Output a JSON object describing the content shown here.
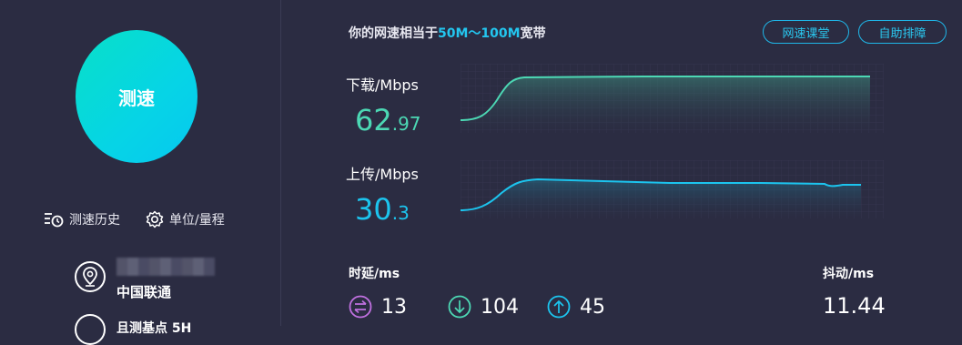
{
  "left": {
    "speed_button": "测速",
    "history_link": "测速历史",
    "units_link": "单位/量程",
    "isp_name": "中国联通",
    "cut_text": "且测基点 5H"
  },
  "header": {
    "equiv_prefix": "你的网速相当于",
    "equiv_range": "50M～100M",
    "equiv_suffix": "宽带",
    "course_button": "网速课堂",
    "troubleshoot_button": "自助排障"
  },
  "download": {
    "label": "下载/Mbps",
    "value_int": "62",
    "value_dec": ".97",
    "color": "#4cd8b4"
  },
  "upload": {
    "label": "上传/Mbps",
    "value_int": "30",
    "value_dec": ".3",
    "color": "#1cc4ee"
  },
  "latency": {
    "label": "时延/ms",
    "bidir": "13",
    "down": "104",
    "up": "45",
    "bidir_icon": "bidirectional-arrows-icon",
    "down_icon": "arrow-down-circle-icon",
    "up_icon": "arrow-up-circle-icon"
  },
  "jitter": {
    "label": "抖动/ms",
    "value": "11.44"
  },
  "colors": {
    "background": "#2b2c42",
    "accent_teal": "#08e0c8",
    "accent_blue": "#1cc4ee",
    "purple": "#c070e0"
  }
}
